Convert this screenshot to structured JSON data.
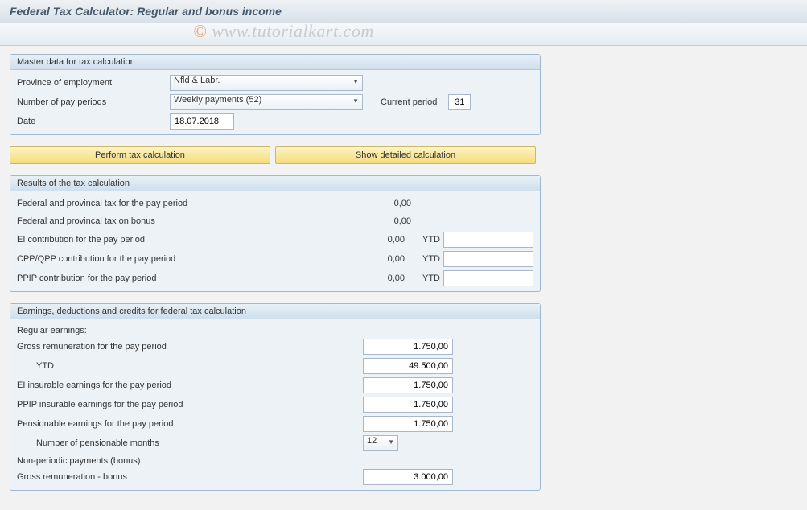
{
  "title": "Federal Tax Calculator: Regular and bonus income",
  "watermark": "© www.tutorialkart.com",
  "master": {
    "header": "Master data for tax calculation",
    "province_label": "Province of employment",
    "province_value": "Nfld & Labr.",
    "periods_label": "Number of pay periods",
    "periods_value": "Weekly payments (52)",
    "current_period_label": "Current period",
    "current_period_value": "31",
    "date_label": "Date",
    "date_value": "18.07.2018"
  },
  "buttons": {
    "perform": "Perform tax calculation",
    "show": "Show detailed calculation"
  },
  "results": {
    "header": "Results of the tax calculation",
    "rows": [
      {
        "label": "Federal and provincal tax for the pay period",
        "value": "0,00",
        "ytd": null
      },
      {
        "label": "Federal and provincal tax on bonus",
        "value": "0,00",
        "ytd": null
      },
      {
        "label": "EI contribution for the pay period",
        "value": "0,00",
        "ytd": ""
      },
      {
        "label": "CPP/QPP contribution for the pay period",
        "value": "0,00",
        "ytd": ""
      },
      {
        "label": "PPIP contribution for the pay period",
        "value": "0,00",
        "ytd": ""
      }
    ],
    "ytd_label": "YTD"
  },
  "earnings": {
    "header": "Earnings, deductions and credits for federal tax calculation",
    "regular_header": "Regular earnings:",
    "gross_label": "Gross remuneration for the pay period",
    "gross_value": "1.750,00",
    "ytd_label": "YTD",
    "ytd_value": "49.500,00",
    "ei_label": "EI insurable earnings for the pay period",
    "ei_value": "1.750,00",
    "ppip_label": "PPIP insurable earnings for the pay period",
    "ppip_value": "1.750,00",
    "pensionable_label": "Pensionable earnings for the pay period",
    "pensionable_value": "1.750,00",
    "months_label": "Number of pensionable months",
    "months_value": "12",
    "nonperiodic_header": "Non-periodic payments (bonus):",
    "bonus_label": "Gross remuneration - bonus",
    "bonus_value": "3.000,00"
  }
}
